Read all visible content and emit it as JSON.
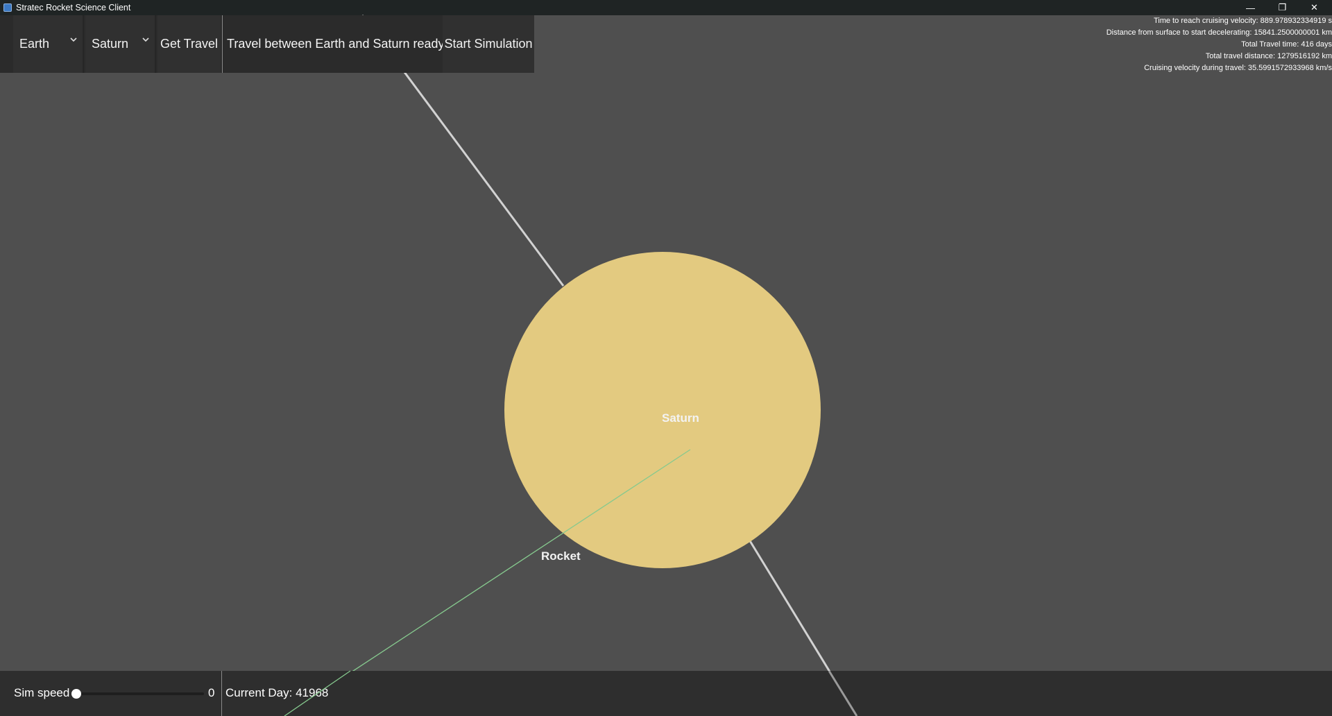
{
  "window": {
    "title": "Stratec Rocket Science Client",
    "controls": {
      "minimize": "—",
      "maximize": "❐",
      "close": "✕"
    }
  },
  "toolbar": {
    "origin_dropdown": {
      "value": "Earth"
    },
    "destination_dropdown": {
      "value": "Saturn"
    },
    "get_travel_label": "Get Travel",
    "status_text": "Travel between Earth and Saturn ready!",
    "start_simulation_label": "Start Simulation"
  },
  "travel_info": {
    "time_to_cruise": "Time to reach cruising velocity: 889.978932334919 s",
    "decel_distance": "Distance from surface to start decelerating: 15841.2500000001 km",
    "total_travel_time": "Total Travel time: 416 days",
    "total_distance": "Total travel distance: 1279516192 km",
    "cruising_velocity": "Cruising velocity during travel: 35.5991572933968 km/s"
  },
  "scene": {
    "planet_label": "Saturn",
    "planet_color": "#e3ca80",
    "rocket_label": "Rocket",
    "trajectory_color": "#86c98e",
    "orbit_color": "#d2d2d2"
  },
  "bottom": {
    "sim_speed_label": "Sim speed",
    "sim_speed_value": "0",
    "current_day": "Current Day: 41968"
  }
}
